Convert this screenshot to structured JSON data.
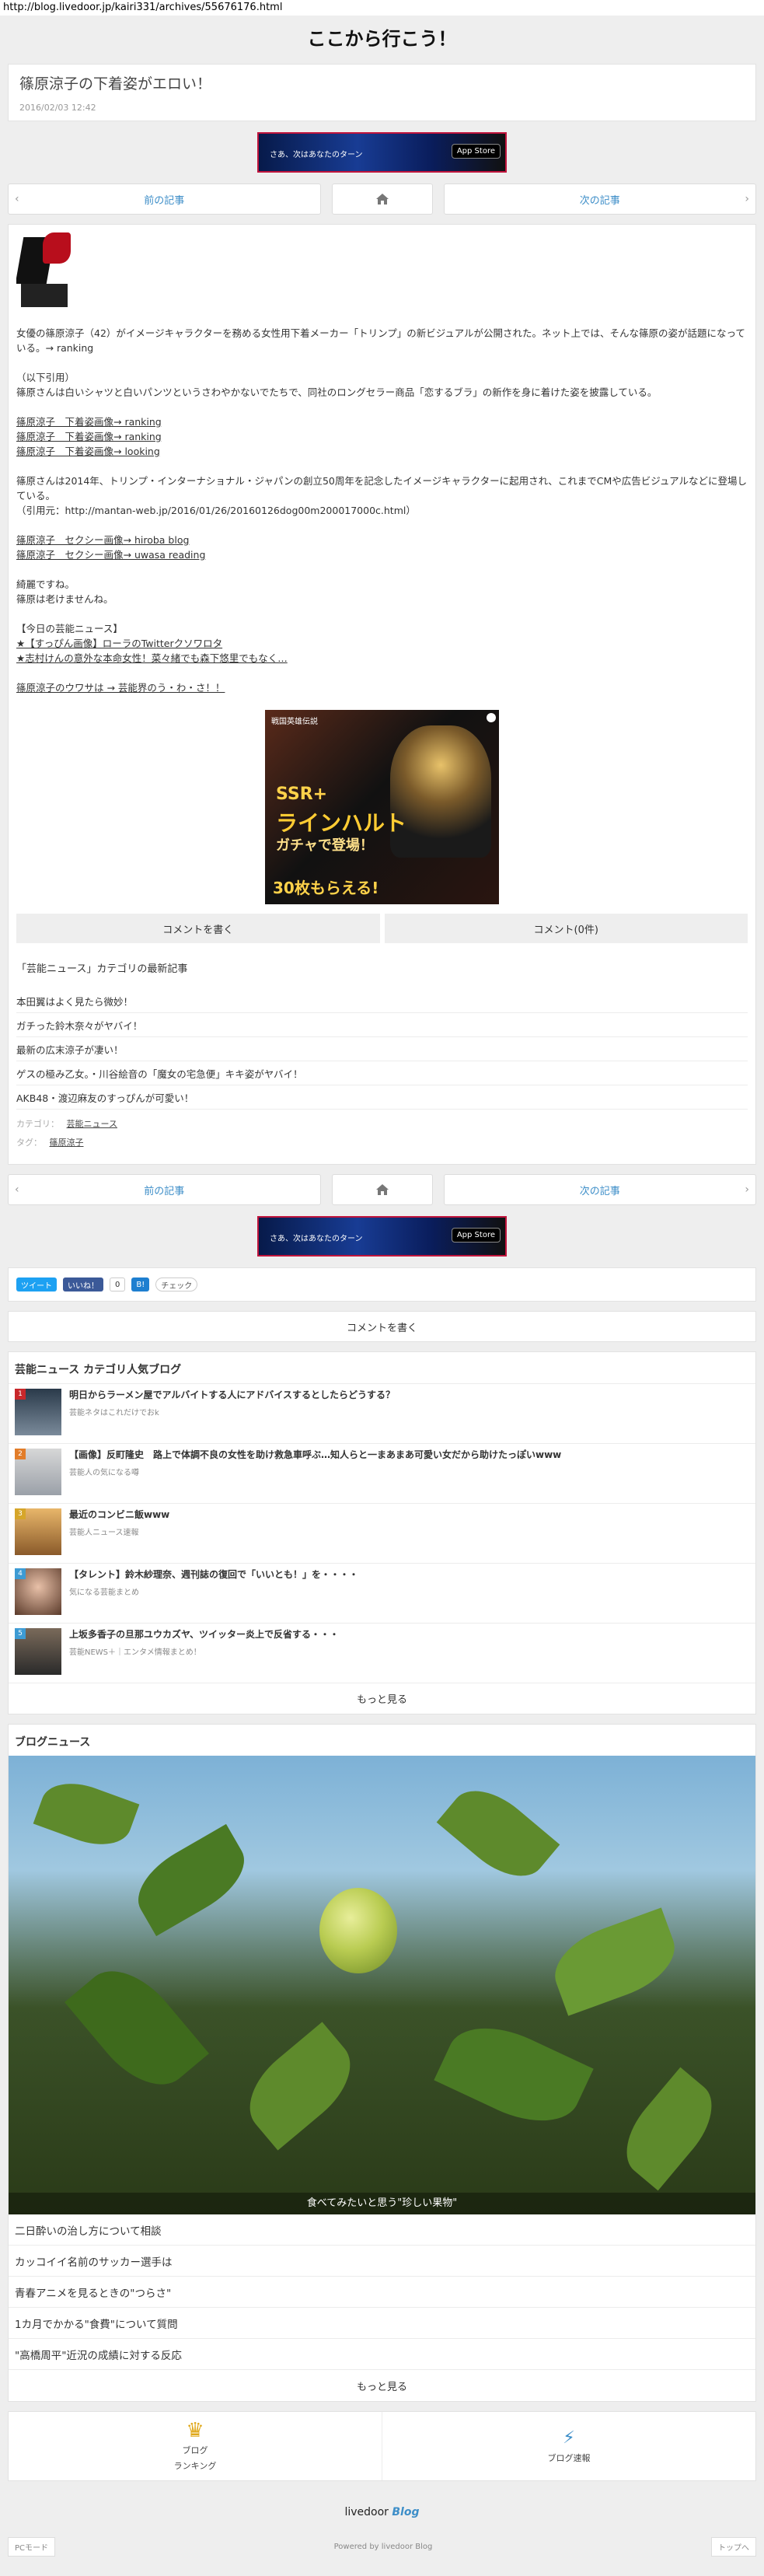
{
  "url": "http://blog.livedoor.jp/kairi331/archives/55676176.html",
  "site_title": "ここから行こう！",
  "article": {
    "title": "篠原涼子の下着姿がエロい！",
    "date": "2016/02/03 12:42",
    "body": [
      [
        "女優の篠原涼子（42）がイメージキャラクターを務める女性用下着メーカー「トリンプ」の新ビジュアルが公開された。ネット上では、そんな篠原の姿が話題になっている。→ ranking"
      ],
      [
        "（以下引用）",
        "篠原さんは白いシャツと白いパンツというさわやかないでたちで、同社のロングセラー商品「恋するブラ」の新作を身に着けた姿を披露している。"
      ],
      [
        "篠原涼子　下着姿画像→ ranking",
        "篠原涼子　下着姿画像→ ranking",
        "篠原涼子　下着姿画像→ looking"
      ],
      [
        "篠原さんは2014年、トリンプ・インターナショナル・ジャパンの創立50周年を記念したイメージキャラクターに起用され、これまでCMや広告ビジュアルなどに登場している。",
        "（引用元：http://mantan-web.jp/2016/01/26/20160126dog00m200017000c.html）"
      ],
      [
        "篠原涼子　セクシー画像→ hiroba blog",
        "篠原涼子　セクシー画像→ uwasa reading"
      ],
      [
        "綺麗ですね。",
        "篠原は老けませんね。"
      ],
      [
        "【今日の芸能ニュース】",
        "★【すっぴん画像】ローラのTwitterクソワロタ",
        "★志村けんの意外な本命女性！菜々緒でも森下悠里でもなく…"
      ],
      [
        "篠原涼子のウワサは → 芸能界のう・わ・さ！！"
      ]
    ]
  },
  "ad": {
    "banner_text": "さあ、次はあなたのターン",
    "appstore": " App Store",
    "inline": {
      "brand": "戦国英雄伝説",
      "ssr": "SSR+",
      "name": "ラインハルト",
      "sub": "ガチャで登場！",
      "ticket": "30枚もらえる!"
    }
  },
  "pager": {
    "prev": "前の記事",
    "next": "次の記事"
  },
  "comment": {
    "write": "コメントを書く",
    "count": "コメント(0件)"
  },
  "latest": {
    "title": "「芸能ニュース」カテゴリの最新記事",
    "items": [
      "本田翼はよく見たら微妙！",
      "ガチった鈴木奈々がヤバイ！",
      "最新の広末涼子が凄い！",
      "ゲスの極み乙女。・川谷絵音の「魔女の宅急便」キキ姿がヤバイ！",
      "AKB48・渡辺麻友のすっぴんが可愛い！"
    ]
  },
  "meta": {
    "category_label": "カテゴリ：",
    "category": "芸能ニュース",
    "tag_label": "タグ：",
    "tag": "篠原涼子"
  },
  "social": {
    "tweet": "ツイート",
    "like": "いいね！",
    "like_count": "0",
    "hatena": "B!",
    "check": "チェック"
  },
  "popular": {
    "title": "芸能ニュース カテゴリ人気ブログ",
    "items": [
      {
        "rank": "1",
        "title": "明日からラーメン屋でアルバイトする人にアドバイスするとしたらどうする？",
        "source": "芸能ネタはこれだけでおk"
      },
      {
        "rank": "2",
        "title": "【画像】反町隆史　路上で体調不良の女性を助け救急車呼ぶ…知人らと一まあまあ可愛い女だから助けたっぽいwww",
        "source": "芸能人の気になる噂"
      },
      {
        "rank": "3",
        "title": "最近のコンビニ飯www",
        "source": "芸能人ニュース速報"
      },
      {
        "rank": "4",
        "title": "【タレント】鈴木紗理奈、週刊誌の復回で「いいとも！」を・・・・",
        "source": "気になる芸能まとめ"
      },
      {
        "rank": "5",
        "title": "上坂多香子の旦那ユウカズヤ、ツイッター炎上で反省する・・・",
        "source": "芸能NEWS＋｜エンタメ情報まとめ！"
      }
    ],
    "more": "もっと見る"
  },
  "blog_news": {
    "title": "ブログニュース",
    "caption": "食べてみたいと思う\"珍しい果物\"",
    "items": [
      "二日酔いの治し方について相談",
      "カッコイイ名前のサッカー選手は",
      "青春アニメを見るときの\"つらさ\"",
      "1カ月でかかる\"食費\"について質問",
      "\"高橋周平\"近況の成績に対する反応"
    ],
    "more": "もっと見る"
  },
  "footer": {
    "ranking_line1": "ブログ",
    "ranking_line2": "ランキング",
    "breaking": "ブログ速報",
    "livedoor": "livedoor",
    "blog": "Blog",
    "pc_mode": "PCモード",
    "powered": "Powered by livedoor Blog",
    "top": "トップへ"
  },
  "colors": {
    "link_blue": "#3d8ec8",
    "bg": "#eeeeee",
    "tweet": "#1da1f2",
    "facebook": "#3b5998"
  }
}
